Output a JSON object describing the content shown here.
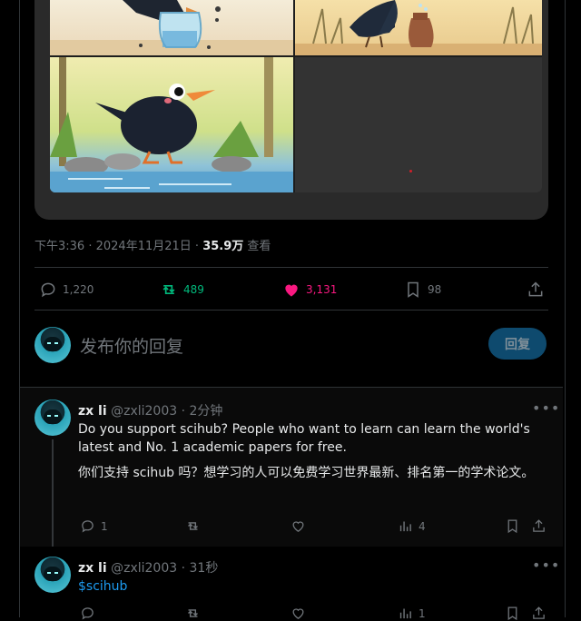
{
  "tweet": {
    "time": "下午3:36",
    "date": "2024年11月21日",
    "views_count": "35.9万",
    "views_label": "查看",
    "replies": "1,220",
    "retweets": "489",
    "likes": "3,131",
    "bookmarks": "98"
  },
  "compose": {
    "placeholder": "发布你的回复",
    "reply_button": "回复"
  },
  "replies": [
    {
      "name": "zx li",
      "handle": "@zxli2003",
      "time": "2分钟",
      "text_en": "Do you support scihub? People who want to learn can learn the world's latest and No. 1 academic papers for free.",
      "text_zh": "你们支持 scihub 吗？想学习的人可以免费学习世界最新、排名第一的学术论文。",
      "reply_count": "1",
      "view_count": "4"
    },
    {
      "name": "zx li",
      "handle": "@zxli2003",
      "time": "31秒",
      "cashtag": "$scihub",
      "view_count": "1"
    }
  ],
  "colors": {
    "retweet_green": "#00ba7c",
    "like_pink": "#f91880",
    "link_blue": "#1d9bf0"
  },
  "icons": [
    "reply-icon",
    "retweet-icon",
    "heart-icon",
    "bookmark-icon",
    "share-icon",
    "more-icon",
    "views-icon"
  ]
}
